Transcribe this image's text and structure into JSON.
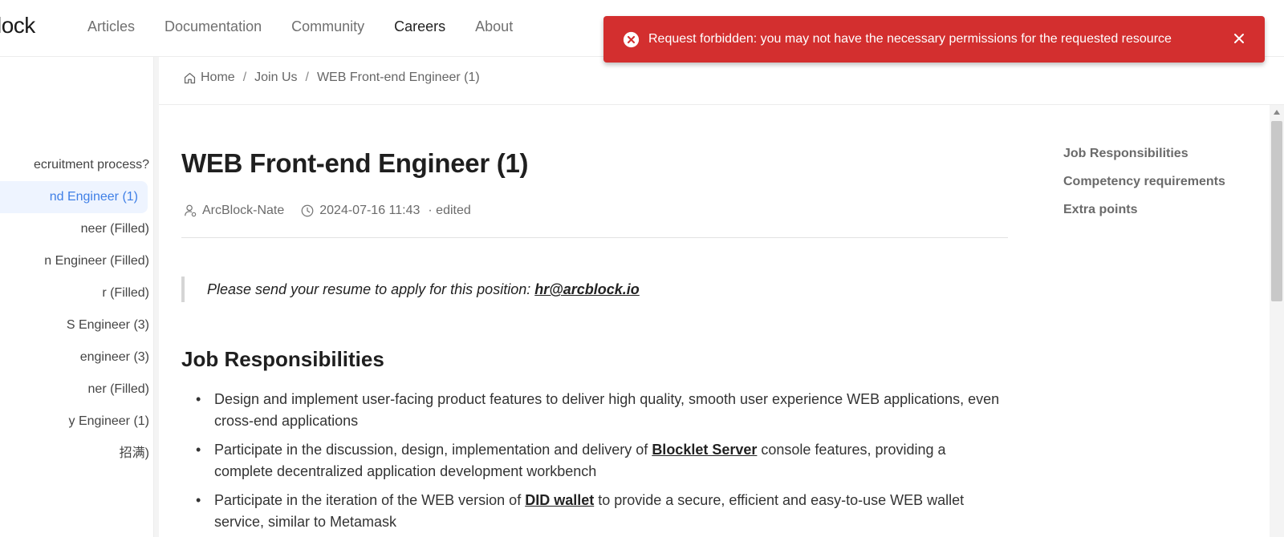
{
  "header": {
    "logo_text": "lock",
    "nav": [
      {
        "label": "Articles"
      },
      {
        "label": "Documentation"
      },
      {
        "label": "Community"
      },
      {
        "label": "Careers"
      },
      {
        "label": "About"
      }
    ],
    "active_nav": "Careers"
  },
  "toast": {
    "icon": "error-circle-icon",
    "message": "Request forbidden: you may not have the necessary permissions for the requested resource",
    "color": "#d32f2f"
  },
  "sidebar": {
    "items": [
      {
        "label": "ecruitment process?"
      },
      {
        "label": "nd Engineer (1)"
      },
      {
        "label": "neer (Filled)"
      },
      {
        "label": "n Engineer (Filled)"
      },
      {
        "label": "r (Filled)"
      },
      {
        "label": "S Engineer (3)"
      },
      {
        "label": "engineer (3)"
      },
      {
        "label": "ner (Filled)"
      },
      {
        "label": "y Engineer (1)"
      },
      {
        "label": "招满)"
      }
    ],
    "active_index": 1
  },
  "breadcrumb": {
    "items": [
      {
        "label": "Home"
      },
      {
        "label": "Join Us"
      },
      {
        "label": "WEB Front-end Engineer (1)"
      }
    ],
    "separator": "/"
  },
  "article": {
    "title": "WEB Front-end Engineer (1)",
    "author": "ArcBlock-Nate",
    "date": "2024-07-16 11:43",
    "edited": "· edited",
    "quote_text": "Please send your resume to apply for this position: ",
    "quote_email": "hr@arcblock.io",
    "section_title": "Job Responsibilities",
    "bullets": [
      {
        "before": "Design and implement user-facing product features to deliver high quality, smooth user experience WEB applications, even cross-end applications",
        "link": "",
        "after": ""
      },
      {
        "before": "Participate in the discussion, design, implementation and delivery of ",
        "link": "Blocklet Server",
        "after": " console features, providing a complete decentralized application development workbench"
      },
      {
        "before": "Participate in the iteration of the WEB version of ",
        "link": "DID wallet",
        "after": " to provide a secure, efficient and easy-to-use WEB wallet service, similar to Metamask"
      }
    ]
  },
  "toc": {
    "items": [
      {
        "label": "Job Responsibilities"
      },
      {
        "label": "Competency requirements"
      },
      {
        "label": "Extra points"
      }
    ]
  },
  "colors": {
    "accent": "#3f7fe6",
    "active_bg": "#eef4ff",
    "error": "#d32f2f"
  }
}
